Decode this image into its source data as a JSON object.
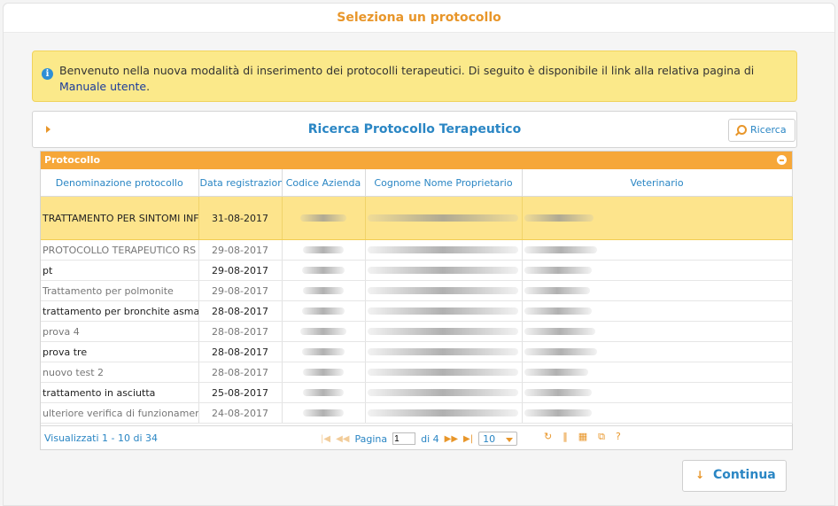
{
  "header": {
    "title": "Seleziona un protocollo"
  },
  "info_banner": {
    "text_before": "Benvenuto nella nuova modalità di inserimento dei protocolli terapeutici. Di seguito è disponibile il link alla relativa pagina di ",
    "link_text": "Manuale utente",
    "text_after": "."
  },
  "search_panel": {
    "title": "Ricerca Protocollo Terapeutico",
    "button_label": "Ricerca"
  },
  "grid": {
    "caption": "Protocollo",
    "columns": [
      "Denominazione protocollo",
      "Data registrazione",
      "Codice Azienda",
      "Cognome Nome Proprietario",
      "Veterinario"
    ],
    "rows": [
      {
        "name": "TRATTAMENTO PER SINTOMI INFIAMMATORI",
        "date": "31-08-2017"
      },
      {
        "name": "PROTOCOLLO TERAPEUTICO RS",
        "date": "29-08-2017"
      },
      {
        "name": "pt",
        "date": "29-08-2017"
      },
      {
        "name": "Trattamento per polmonite",
        "date": "29-08-2017"
      },
      {
        "name": "trattamento per bronchite asmatica",
        "date": "28-08-2017"
      },
      {
        "name": "prova 4",
        "date": "28-08-2017"
      },
      {
        "name": "prova tre",
        "date": "28-08-2017"
      },
      {
        "name": "nuovo test 2",
        "date": "28-08-2017"
      },
      {
        "name": "trattamento in asciutta",
        "date": "25-08-2017"
      },
      {
        "name": "ulteriore verifica di funzionamento",
        "date": "24-08-2017"
      }
    ]
  },
  "pager": {
    "records_info": "Visualizzati 1 - 10 di 34",
    "page_label": "Pagina",
    "page_value": "1",
    "of_label": "di 4",
    "page_size": "10"
  },
  "continue_button": {
    "label": "Continua"
  }
}
